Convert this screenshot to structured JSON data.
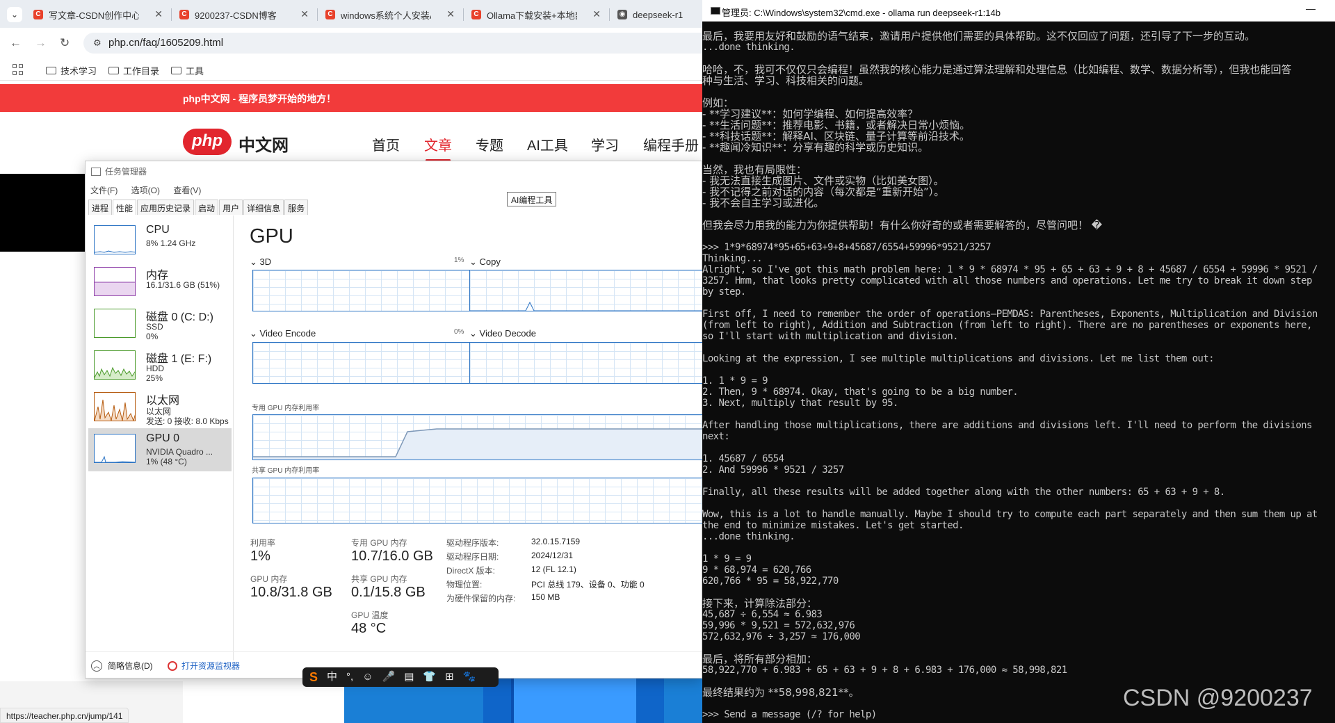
{
  "browser": {
    "tabs": [
      {
        "title": "写文章-CSDN创作中心",
        "icon": "csdn-c-icon"
      },
      {
        "title": "9200237-CSDN博客",
        "icon": "csdn-c-icon"
      },
      {
        "title": "windows系统个人安装AI",
        "icon": "csdn-c-icon"
      },
      {
        "title": "Ollama下载安装+本地部",
        "icon": "csdn-c-icon"
      },
      {
        "title": "deepseek-r1",
        "icon": "ollama-icon"
      }
    ],
    "url": "php.cn/faq/1605209.html",
    "bookmarks": [
      "技术学习",
      "工作目录",
      "工具"
    ],
    "status_url": "https://teacher.php.cn/jump/141"
  },
  "site": {
    "promo": "php中文网 - 程序员梦开始的地方！",
    "logo_pill": "php",
    "logo_text": "中文网",
    "nav": [
      "首页",
      "文章",
      "专题",
      "AI工具",
      "学习",
      "编程手册"
    ],
    "active_nav": "文章",
    "tooltip": "AI编程工具"
  },
  "taskmgr": {
    "title": "任务管理器",
    "menu": [
      "文件(F)",
      "选项(O)",
      "查看(V)"
    ],
    "tabs": [
      "进程",
      "性能",
      "应用历史记录",
      "启动",
      "用户",
      "详细信息",
      "服务"
    ],
    "active_tab": "性能",
    "side": [
      {
        "name": "CPU",
        "sub1": "8% 1.24 GHz",
        "sub2": ""
      },
      {
        "name": "内存",
        "sub1": "16.1/31.6 GB (51%)",
        "sub2": ""
      },
      {
        "name": "磁盘 0 (C: D:)",
        "sub1": "SSD",
        "sub2": "0%"
      },
      {
        "name": "磁盘 1 (E: F:)",
        "sub1": "HDD",
        "sub2": "25%"
      },
      {
        "name": "以太网",
        "sub1": "以太网",
        "sub2": "发送: 0 接收: 8.0 Kbps"
      },
      {
        "name": "GPU 0",
        "sub1": "NVIDIA Quadro ...",
        "sub2": "1% (48 °C)"
      }
    ],
    "gpu_heading": "GPU",
    "engines": [
      {
        "label": "3D",
        "pct": "1%"
      },
      {
        "label": "Copy",
        "pct": ""
      },
      {
        "label": "Video Encode",
        "pct": "0%"
      },
      {
        "label": "Video Decode",
        "pct": ""
      }
    ],
    "dedicated_mem_label": "专用 GPU 内存利用率",
    "shared_mem_label": "共享 GPU 内存利用率",
    "stats": {
      "util_label": "利用率",
      "util_value": "1%",
      "ded_label": "专用 GPU 内存",
      "ded_value": "10.7/16.0 GB",
      "gpumem_label": "GPU 内存",
      "gpumem_value": "10.8/31.8 GB",
      "shared_label": "共享 GPU 内存",
      "shared_value": "0.1/15.8 GB",
      "temp_label": "GPU 温度",
      "temp_value": "48 °C"
    },
    "info": [
      {
        "label": "驱动程序版本:",
        "value": "32.0.15.7159"
      },
      {
        "label": "驱动程序日期:",
        "value": "2024/12/31"
      },
      {
        "label": "DirectX 版本:",
        "value": "12 (FL 12.1)"
      },
      {
        "label": "物理位置:",
        "value": "PCI 总线 179、设备 0、功能 0"
      },
      {
        "label": "为硬件保留的内存:",
        "value": "150 MB"
      }
    ],
    "brief": "简略信息(D)",
    "resmon": "打开资源监视器"
  },
  "ime": [
    "S",
    "中",
    "°,",
    "☺",
    "🎤",
    "▤",
    "👕",
    "⊞",
    "🐾"
  ],
  "cmd": {
    "title": "管理员: C:\\Windows\\system32\\cmd.exe - ollama  run deepseek-r1:14b",
    "lines": [
      "最后，我要用友好和鼓励的语气结束，邀请用户提供他们需要的具体帮助。这不仅回应了问题，还引导了下一步的互动。",
      "...done thinking.",
      "",
      "哈哈，不，我可不仅仅只会编程！虽然我的核心能力是通过算法理解和处理信息（比如编程、数学、数据分析等），但我也能回答",
      "种与生活、学习、科技相关的问题。",
      "",
      "例如：",
      "- **学习建议**：如何学编程、如何提高效率？",
      "- **生活问题**：推荐电影、书籍，或者解决日常小烦恼。",
      "- **科技话题**：解释AI、区块链、量子计算等前沿技术。",
      "- **趣闻冷知识**：分享有趣的科学或历史知识。",
      "",
      "当然，我也有局限性：",
      "- 我无法直接生成图片、文件或实物（比如美女图）。",
      "- 我不记得之前对话的内容（每次都是“重新开始”）。",
      "- 我不会自主学习或进化。",
      "",
      "但我会尽力用我的能力为你提供帮助！有什么你好奇的或者需要解答的，尽管问吧！ �",
      "",
      ">>> 1*9*68974*95+65+63+9+8+45687/6554+59996*9521/3257",
      "Thinking...",
      "Alright, so I've got this math problem here: 1 * 9 * 68974 * 95 + 65 + 63 + 9 + 8 + 45687 / 6554 + 59996 * 9521 /",
      "3257. Hmm, that looks pretty complicated with all those numbers and operations. Let me try to break it down step",
      "by step.",
      "",
      "First off, I need to remember the order of operations—PEMDAS: Parentheses, Exponents, Multiplication and Division",
      "(from left to right), Addition and Subtraction (from left to right). There are no parentheses or exponents here,",
      "so I'll start with multiplication and division.",
      "",
      "Looking at the expression, I see multiple multiplications and divisions. Let me list them out:",
      "",
      "1. 1 * 9 = 9",
      "2. Then, 9 * 68974. Okay, that's going to be a big number.",
      "3. Next, multiply that result by 95.",
      "",
      "After handling those multiplications, there are additions and divisions left. I'll need to perform the divisions",
      "next:",
      "",
      "1. 45687 / 6554",
      "2. And 59996 * 9521 / 3257",
      "",
      "Finally, all these results will be added together along with the other numbers: 65 + 63 + 9 + 8.",
      "",
      "Wow, this is a lot to handle manually. Maybe I should try to compute each part separately and then sum them up at",
      "the end to minimize mistakes. Let's get started.",
      "...done thinking.",
      "",
      "1 * 9 = 9",
      "9 * 68,974 = 620,766",
      "620,766 * 95 = 58,922,770",
      "",
      "接下来，计算除法部分：",
      "45,687 ÷ 6,554 ≈ 6.983",
      "59,996 * 9,521 = 572,632,976",
      "572,632,976 ÷ 3,257 ≈ 176,000",
      "",
      "最后，将所有部分相加：",
      "58,922,770 + 6.983 + 65 + 63 + 9 + 8 + 6.983 + 176,000 ≈ 58,998,821",
      "",
      "最终结果约为 **58,998,821**。",
      "",
      ">>> Send a message (/? for help)"
    ]
  },
  "watermark": "CSDN @9200237"
}
